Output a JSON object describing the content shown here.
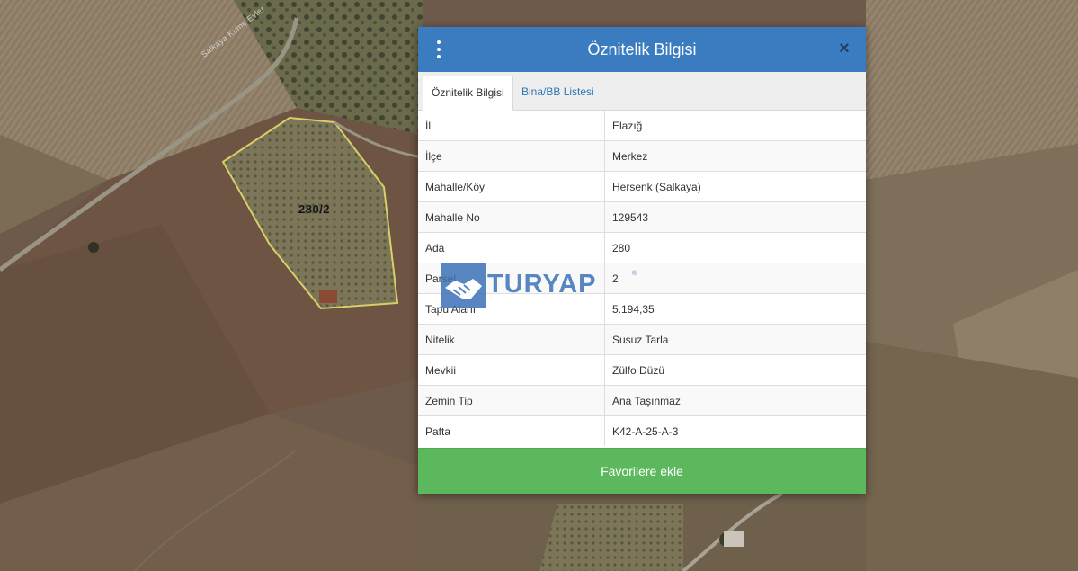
{
  "map": {
    "parcel_label": "280/2",
    "road_label": "Salkaya Kume Evler"
  },
  "modal": {
    "title": "Öznitelik Bilgisi",
    "close_symbol": "×",
    "tabs": [
      {
        "label": "Öznitelik Bilgisi",
        "active": true
      },
      {
        "label": "Bina/BB Listesi",
        "active": false
      }
    ],
    "rows": [
      {
        "key": "İl",
        "value": "Elazığ"
      },
      {
        "key": "İlçe",
        "value": "Merkez"
      },
      {
        "key": "Mahalle/Köy",
        "value": "Hersenk (Salkaya)"
      },
      {
        "key": "Mahalle No",
        "value": "129543"
      },
      {
        "key": "Ada",
        "value": "280"
      },
      {
        "key": "Parsel",
        "value": "2"
      },
      {
        "key": "Tapu Alanı",
        "value": "5.194,35"
      },
      {
        "key": "Nitelik",
        "value": "Susuz Tarla"
      },
      {
        "key": "Mevkii",
        "value": "Zülfo Düzü"
      },
      {
        "key": "Zemin Tip",
        "value": "Ana Taşınmaz"
      },
      {
        "key": "Pafta",
        "value": "K42-A-25-A-3"
      }
    ],
    "favorite_button": "Favorilere ekle"
  },
  "watermark": {
    "text": "TURYAP",
    "mark": "®"
  },
  "colors": {
    "header": "#3b7cc1",
    "button": "#5cb85c",
    "parcel_outline": "#d6cf6a"
  }
}
